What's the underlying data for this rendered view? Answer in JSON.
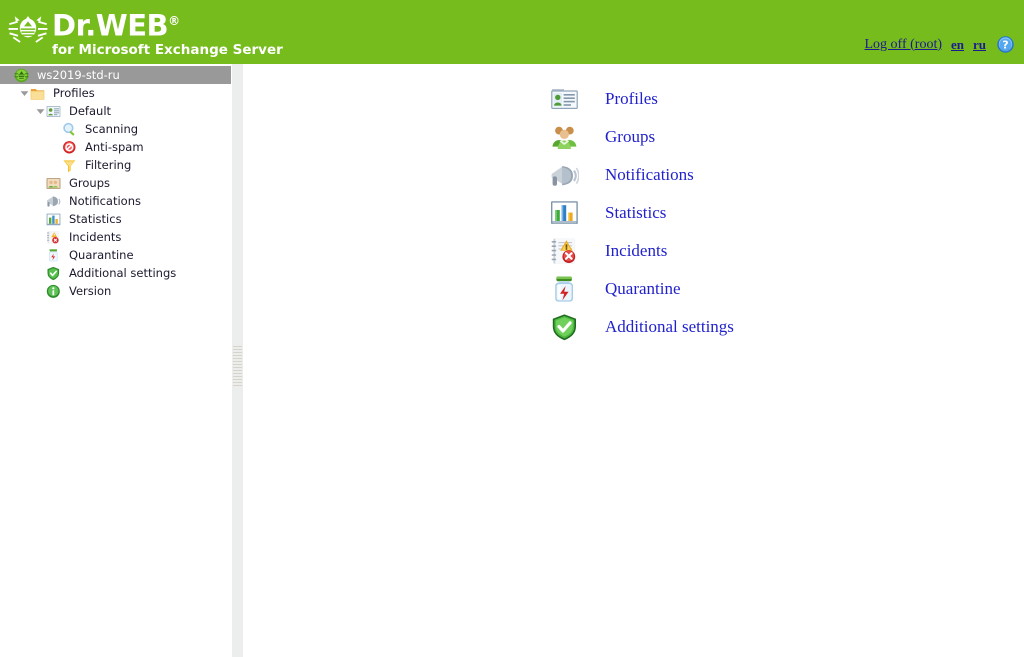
{
  "header": {
    "brand": "Dr.WEB",
    "brand_sup": "®",
    "subtitle": "for Microsoft Exchange Server",
    "logo_icon": "drweb-spider-icon",
    "background_color": "#76bc1c",
    "logoff_label": "Log off (root)",
    "lang_en": "en",
    "lang_ru": "ru",
    "help_icon": "help-question-icon",
    "link_color": "#1b1b8f"
  },
  "sidebar": {
    "tree": [
      {
        "label": "ws2019-std-ru",
        "icon": "server-spider-icon",
        "depth": 0,
        "twisty": "expanded",
        "selected": true
      },
      {
        "label": "Profiles",
        "icon": "folder-icon",
        "depth": 1,
        "twisty": "expanded",
        "selected": false
      },
      {
        "label": "Default",
        "icon": "profile-card-icon",
        "depth": 2,
        "twisty": "expanded",
        "selected": false
      },
      {
        "label": "Scanning",
        "icon": "magnifier-icon",
        "depth": 3,
        "twisty": "none",
        "selected": false
      },
      {
        "label": "Anti-spam",
        "icon": "no-entry-icon",
        "depth": 3,
        "twisty": "none",
        "selected": false
      },
      {
        "label": "Filtering",
        "icon": "funnel-icon",
        "depth": 3,
        "twisty": "none",
        "selected": false
      },
      {
        "label": "Groups",
        "icon": "groups-icon",
        "depth": 2,
        "twisty": "none",
        "selected": false
      },
      {
        "label": "Notifications",
        "icon": "megaphone-icon",
        "depth": 2,
        "twisty": "none",
        "selected": false
      },
      {
        "label": "Statistics",
        "icon": "bar-chart-icon",
        "depth": 2,
        "twisty": "none",
        "selected": false
      },
      {
        "label": "Incidents",
        "icon": "incident-notepad-icon",
        "depth": 2,
        "twisty": "none",
        "selected": false
      },
      {
        "label": "Quarantine",
        "icon": "quarantine-jar-icon",
        "depth": 2,
        "twisty": "none",
        "selected": false
      },
      {
        "label": "Additional settings",
        "icon": "shield-check-icon",
        "depth": 2,
        "twisty": "none",
        "selected": false
      },
      {
        "label": "Version",
        "icon": "info-icon",
        "depth": 2,
        "twisty": "none",
        "selected": false
      }
    ],
    "selected_bg_color": "#999999"
  },
  "splitter": {
    "grip_icon": "vertical-grip-handle"
  },
  "main": {
    "menu": [
      {
        "label": "Profiles",
        "icon": "profile-card-large-icon"
      },
      {
        "label": "Groups",
        "icon": "groups-large-icon"
      },
      {
        "label": "Notifications",
        "icon": "megaphone-large-icon"
      },
      {
        "label": "Statistics",
        "icon": "bar-chart-large-icon"
      },
      {
        "label": "Incidents",
        "icon": "incident-notepad-large-icon"
      },
      {
        "label": "Quarantine",
        "icon": "quarantine-jar-large-icon"
      },
      {
        "label": "Additional settings",
        "icon": "shield-check-large-icon"
      }
    ],
    "link_color": "#2222cc"
  }
}
